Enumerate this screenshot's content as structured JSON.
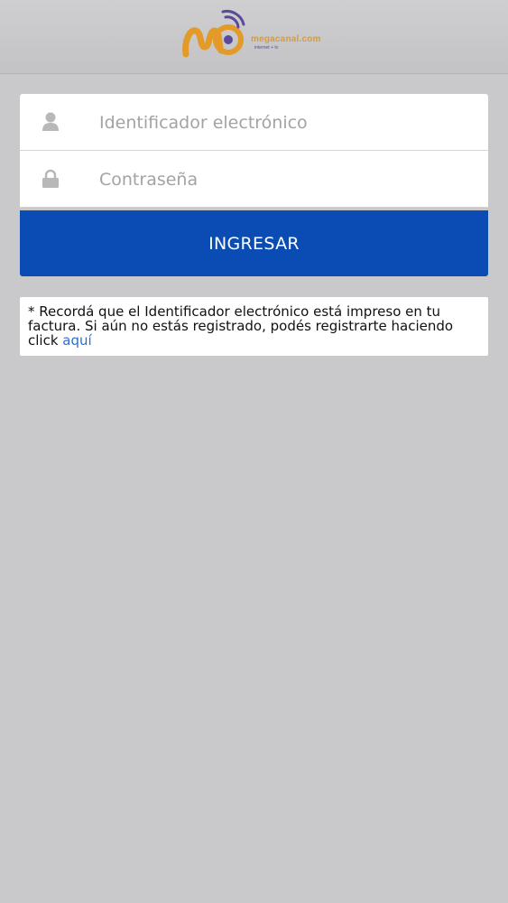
{
  "header": {
    "logo": {
      "name": "megacanal.com",
      "tagline": "internet + tv",
      "colors": {
        "orange": "#e09a2b",
        "purple": "#5a4a9a"
      }
    }
  },
  "login": {
    "id_field": {
      "placeholder": "Identificador electrónico",
      "value": "",
      "icon": "user-icon"
    },
    "password_field": {
      "placeholder": "Contraseña",
      "value": "",
      "icon": "lock-icon"
    },
    "submit_label": "INGRESAR",
    "accent_color": "#0b4cb4"
  },
  "notice": {
    "text": "* Recordá que el Identificador electrónico está impreso en tu factura. Si aún no estás registrado, podés registrarte haciendo click ",
    "link_text": "aquí"
  }
}
